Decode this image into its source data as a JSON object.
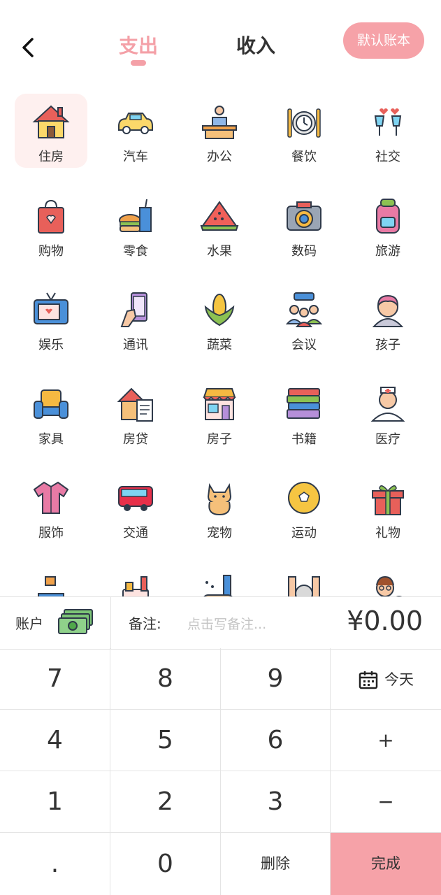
{
  "header": {
    "tab_expense": "支出",
    "tab_income": "收入",
    "default_book": "默认账本",
    "accent": "#f6a2a8"
  },
  "categories": [
    {
      "label": "住房",
      "icon": "house-icon"
    },
    {
      "label": "汽车",
      "icon": "car-icon"
    },
    {
      "label": "办公",
      "icon": "office-desk-icon"
    },
    {
      "label": "餐饮",
      "icon": "dining-icon"
    },
    {
      "label": "社交",
      "icon": "social-glasses-icon"
    },
    {
      "label": "购物",
      "icon": "shopping-bag-icon"
    },
    {
      "label": "零食",
      "icon": "snacks-icon"
    },
    {
      "label": "水果",
      "icon": "watermelon-icon"
    },
    {
      "label": "数码",
      "icon": "camera-icon"
    },
    {
      "label": "旅游",
      "icon": "backpack-icon"
    },
    {
      "label": "娱乐",
      "icon": "tv-icon"
    },
    {
      "label": "通讯",
      "icon": "phone-icon"
    },
    {
      "label": "蔬菜",
      "icon": "corn-icon"
    },
    {
      "label": "会议",
      "icon": "meeting-icon"
    },
    {
      "label": "孩子",
      "icon": "child-icon"
    },
    {
      "label": "家具",
      "icon": "armchair-icon"
    },
    {
      "label": "房贷",
      "icon": "mortgage-icon"
    },
    {
      "label": "房子",
      "icon": "shop-house-icon"
    },
    {
      "label": "书籍",
      "icon": "books-icon"
    },
    {
      "label": "医疗",
      "icon": "nurse-icon"
    },
    {
      "label": "服饰",
      "icon": "shirt-icon"
    },
    {
      "label": "交通",
      "icon": "bus-icon"
    },
    {
      "label": "宠物",
      "icon": "cat-icon"
    },
    {
      "label": "运动",
      "icon": "football-icon"
    },
    {
      "label": "礼物",
      "icon": "gift-icon"
    },
    {
      "label": "",
      "icon": "delivery-icon"
    },
    {
      "label": "",
      "icon": "drinks-icon"
    },
    {
      "label": "",
      "icon": "game-icon"
    },
    {
      "label": "",
      "icon": "elder-icon"
    },
    {
      "label": "",
      "icon": "teacher-icon"
    }
  ],
  "selected_category": "住房",
  "input_bar": {
    "account_label": "账户",
    "note_label": "备注:",
    "note_placeholder": "点击写备注...",
    "amount": "¥0.00"
  },
  "keypad": {
    "k7": "7",
    "k8": "8",
    "k9": "9",
    "today": "今天",
    "k4": "4",
    "k5": "5",
    "k6": "6",
    "plus": "+",
    "k1": "1",
    "k2": "2",
    "k3": "3",
    "minus": "−",
    "dot": ".",
    "k0": "0",
    "delete": "删除",
    "done": "完成"
  }
}
